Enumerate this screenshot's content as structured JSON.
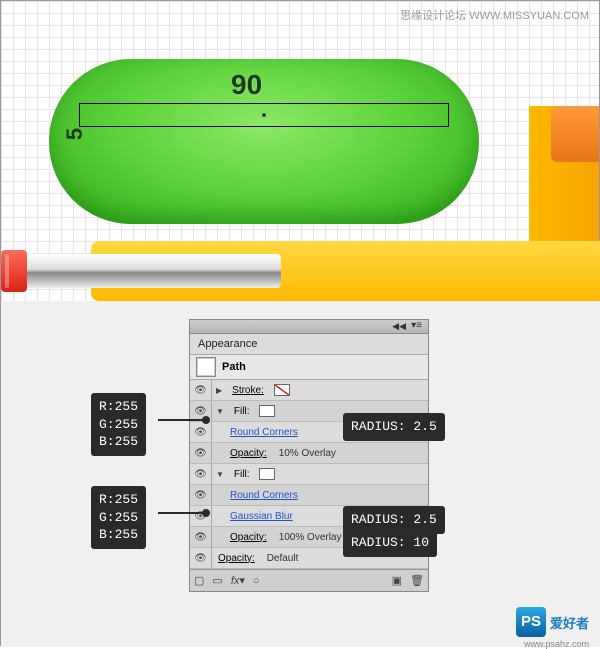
{
  "top_watermark": "思缘设计论坛  WWW.MISSYUAN.COM",
  "canvas": {
    "dim_width": "90",
    "dim_height": "5"
  },
  "panel": {
    "title": "Appearance",
    "object": "Path",
    "rows": {
      "stroke_label": "Stroke:",
      "fill_label": "Fill:",
      "round_corners": "Round Corners",
      "gaussian_blur": "Gaussian Blur",
      "opacity_label": "Opacity:",
      "op_10": "10% Overlay",
      "op_100": "100% Overlay",
      "op_default": "Default"
    },
    "footer": {
      "fx": "fx"
    }
  },
  "callouts": {
    "rgb": "R:255\nG:255\nB:255",
    "radius25": "RADIUS: 2.5",
    "radius10": "RADIUS: 10"
  },
  "logo": {
    "badge": "PS",
    "text": "爱好者",
    "url": "www.psahz.com"
  }
}
